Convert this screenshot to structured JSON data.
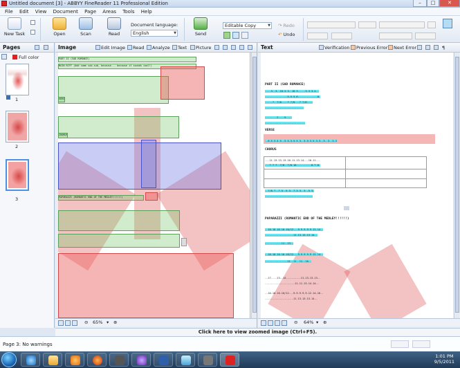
{
  "window": {
    "title": "Untitled document [3] - ABBYY FineReader 11 Professional Edition",
    "minimize": "–",
    "maximize": "□",
    "close": "✕"
  },
  "menu": [
    "File",
    "Edit",
    "View",
    "Document",
    "Page",
    "Areas",
    "Tools",
    "Help"
  ],
  "toolbar": {
    "new_task": "New Task",
    "open": "Open",
    "scan": "Scan",
    "read": "Read",
    "doc_lang_label": "Document language:",
    "doc_lang_value": "English",
    "send": "Send",
    "format_value": "Editable Copy",
    "redo": "Redo",
    "undo": "Undo"
  },
  "pages_pane": {
    "title": "Pages",
    "mode": "Full color",
    "pages": [
      {
        "num": "1",
        "warn": true
      },
      {
        "num": "2",
        "warn": false
      },
      {
        "num": "3",
        "warn": false
      }
    ]
  },
  "image_pane": {
    "title": "Image",
    "edit_image": "Edit Image",
    "read": "Read",
    "analyze": "Analyze",
    "text": "Text",
    "picture": "Picture",
    "zoom": "65%"
  },
  "text_pane": {
    "title": "Text",
    "verification": "Verification",
    "prev_error": "Previous Error",
    "next_error": "Next Error",
    "zoom": "64%"
  },
  "doc": {
    "heading1": "PART II (SAD ROMANCE)",
    "heading2": "MAIN RIFF (Add some sub-sub, because... because it sounds cool!)",
    "verse": "VERSE",
    "chorus": "CHORUS",
    "fadeout": "PAPARAZZI (ROMANTIC END OF THE MEDLEY!!!!!!)"
  },
  "zoom_hint": "Click here to view zoomed image (Ctrl+F5).",
  "status": "Page 3: No warnings",
  "clock": {
    "time": "1:01 PM",
    "date": "9/5/2011"
  },
  "colors": {
    "green_block": "#78c86e",
    "blue_block": "#7882e6",
    "red_block": "#eb5a5a",
    "highlight": "#66e6f2"
  }
}
